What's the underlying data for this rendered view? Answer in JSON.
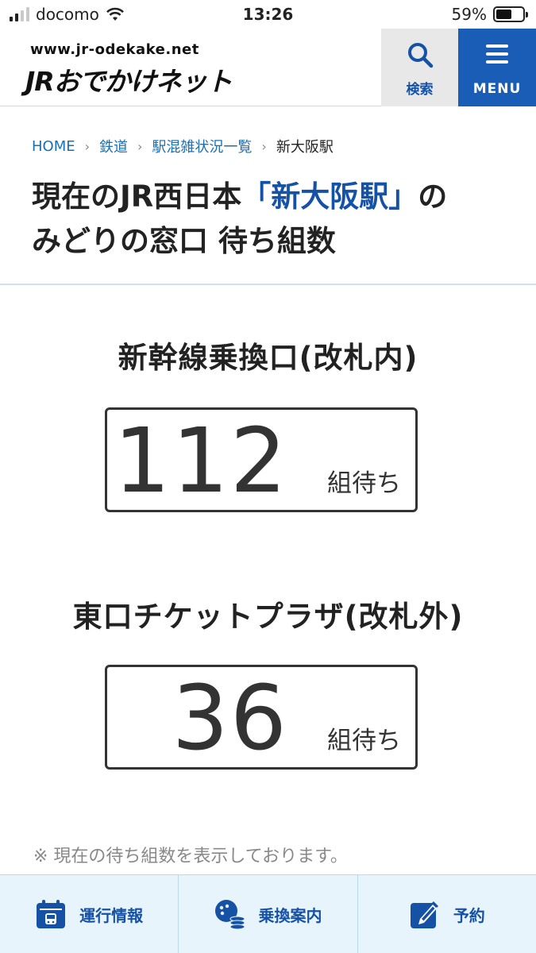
{
  "status_bar": {
    "carrier": "docomo",
    "time": "13:26",
    "battery": "59%",
    "battery_level": 0.59
  },
  "header": {
    "site_url": "www.jr-odekake.net",
    "logo_text": "JRおでかけネット",
    "search_label": "検索",
    "menu_label": "MENU"
  },
  "breadcrumb": {
    "items": [
      "HOME",
      "鉄道",
      "駅混雑状況一覧"
    ],
    "current": "新大阪駅"
  },
  "title": {
    "part1": "現在のJR西日本",
    "station": "「新大阪駅」",
    "part2": "の",
    "line2": "みどりの窓口 待ち組数"
  },
  "counters": [
    {
      "name": "新幹線乗換口(改札内)",
      "count": "112",
      "unit": "組待ち"
    },
    {
      "name": "東口チケットプラザ(改札外)",
      "count": "36",
      "unit": "組待ち"
    }
  ],
  "note": "※ 現在の待ち組数を表示しております。",
  "bottom_nav": {
    "items": [
      {
        "label": "運行情報",
        "icon": "calendar-train-icon"
      },
      {
        "label": "乗換案内",
        "icon": "transfer-icon"
      },
      {
        "label": "予約",
        "icon": "edit-icon"
      }
    ]
  },
  "colors": {
    "brand_blue": "#1552a6",
    "menu_blue": "#1a5db7",
    "link_blue": "#1a6fb5",
    "nav_bg": "#e8f4fb"
  }
}
